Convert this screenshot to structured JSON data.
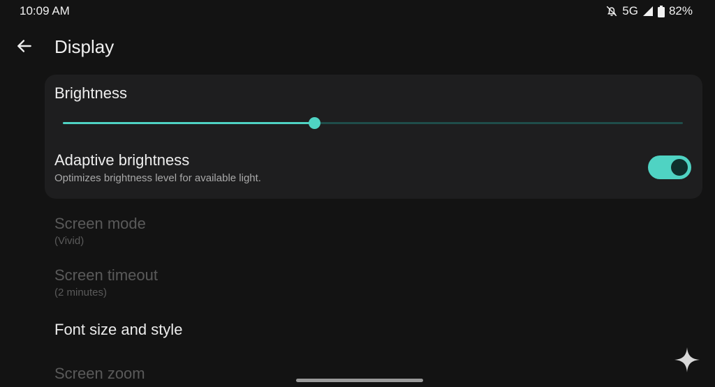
{
  "status_bar": {
    "time": "10:09 AM",
    "network": "5G",
    "battery": "82%"
  },
  "header": {
    "title": "Display"
  },
  "brightness_card": {
    "heading": "Brightness",
    "slider_value": 0.405,
    "adaptive": {
      "title": "Adaptive brightness",
      "subtitle": "Optimizes brightness level for available light.",
      "enabled": true
    }
  },
  "settings": {
    "screen_mode": {
      "title": "Screen mode",
      "subtitle": "(Vivid)"
    },
    "screen_timeout": {
      "title": "Screen timeout",
      "subtitle": "(2 minutes)"
    },
    "font_size": {
      "title": "Font size and style"
    },
    "screen_zoom": {
      "title": "Screen zoom"
    }
  },
  "colors": {
    "accent": "#4fd3c3",
    "background": "#131313",
    "card": "#1e1e1f"
  },
  "icons": {
    "back": "arrow-left-icon",
    "notifications_off": "bell-off-icon",
    "signal": "signal-icon",
    "battery": "battery-icon",
    "assistant": "sparkle-icon"
  }
}
